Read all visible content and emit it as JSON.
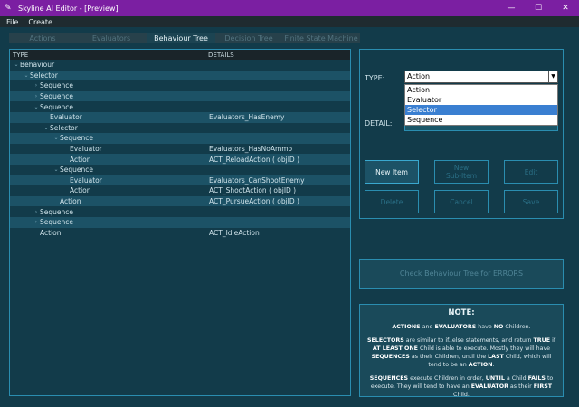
{
  "window": {
    "title": "Skyline AI Editor - [Preview]",
    "controls": {
      "minimize": "—",
      "maximize": "☐",
      "close": "✕"
    }
  },
  "menu": [
    "File",
    "Create"
  ],
  "tabs": [
    {
      "label": "Actions",
      "active": false
    },
    {
      "label": "Evaluators",
      "active": false
    },
    {
      "label": "Behaviour Tree",
      "active": true
    },
    {
      "label": "Decision Tree",
      "active": false
    },
    {
      "label": "Finite State Machine",
      "active": false
    }
  ],
  "tree": {
    "columns": {
      "type": "TYPE",
      "details": "DETAILS"
    },
    "rows": [
      {
        "label": "Behaviour",
        "detail": "",
        "depth": 0,
        "expanded": true
      },
      {
        "label": "Selector",
        "detail": "",
        "depth": 1,
        "expanded": true
      },
      {
        "label": "Sequence",
        "detail": "",
        "depth": 2,
        "expanded": false
      },
      {
        "label": "Sequence",
        "detail": "",
        "depth": 2,
        "expanded": false
      },
      {
        "label": "Sequence",
        "detail": "",
        "depth": 2,
        "expanded": true
      },
      {
        "label": "Evaluator",
        "detail": "Evaluators_HasEnemy",
        "depth": 3
      },
      {
        "label": "Selector",
        "detail": "",
        "depth": 3,
        "expanded": true
      },
      {
        "label": "Sequence",
        "detail": "",
        "depth": 4,
        "expanded": true
      },
      {
        "label": "Evaluator",
        "detail": "Evaluators_HasNoAmmo",
        "depth": 5
      },
      {
        "label": "Action",
        "detail": "ACT_ReloadAction ( objID )",
        "depth": 5
      },
      {
        "label": "Sequence",
        "detail": "",
        "depth": 4,
        "expanded": true
      },
      {
        "label": "Evaluator",
        "detail": "Evaluators_CanShootEnemy",
        "depth": 5
      },
      {
        "label": "Action",
        "detail": "ACT_ShootAction ( objID )",
        "depth": 5
      },
      {
        "label": "Action",
        "detail": "ACT_PursueAction ( objID )",
        "depth": 4
      },
      {
        "label": "Sequence",
        "detail": "",
        "depth": 2,
        "expanded": false
      },
      {
        "label": "Sequence",
        "detail": "",
        "depth": 2,
        "expanded": false
      },
      {
        "label": "Action",
        "detail": "ACT_IdleAction",
        "depth": 2
      }
    ]
  },
  "editor": {
    "type_label": "TYPE:",
    "detail_label": "DETAIL:",
    "type_selected": "Action",
    "type_options": [
      "Action",
      "Evaluator",
      "Selector",
      "Sequence"
    ],
    "highlighted_option": "Selector"
  },
  "buttons": {
    "new_item": "New Item",
    "new_subitem": "New\nSub-Item",
    "edit": "Edit",
    "delete": "Delete",
    "cancel": "Cancel",
    "save": "Save",
    "check": "Check Behaviour Tree for ERRORS"
  },
  "note": {
    "title": "NOTE:",
    "p1": "<b>ACTIONS</b> and <b>EVALUATORS</b> have <b>NO</b> Children.",
    "p2": "<b>SELECTORS</b> are similar to if..else statements, and return <b>TRUE</b> if <b>AT LEAST ONE</b> Child is able to execute. Mostly they will have <b>SEQUENCES</b> as their Children, until the <b>LAST</b> Child, which will tend to be an <b>ACTION</b>.",
    "p3": "<b>SEQUENCES</b> execute Children in order, <b>UNTIL</b> a Child <b>FAILS</b> to execute. They will tend to have an <b>EVALUATOR</b> as their <b>FIRST</b> Child."
  },
  "colors": {
    "titlebar": "#7b1fa2",
    "background": "#123b4a",
    "accent_border": "#2a8db0",
    "selected_option": "#3a7fd1"
  }
}
